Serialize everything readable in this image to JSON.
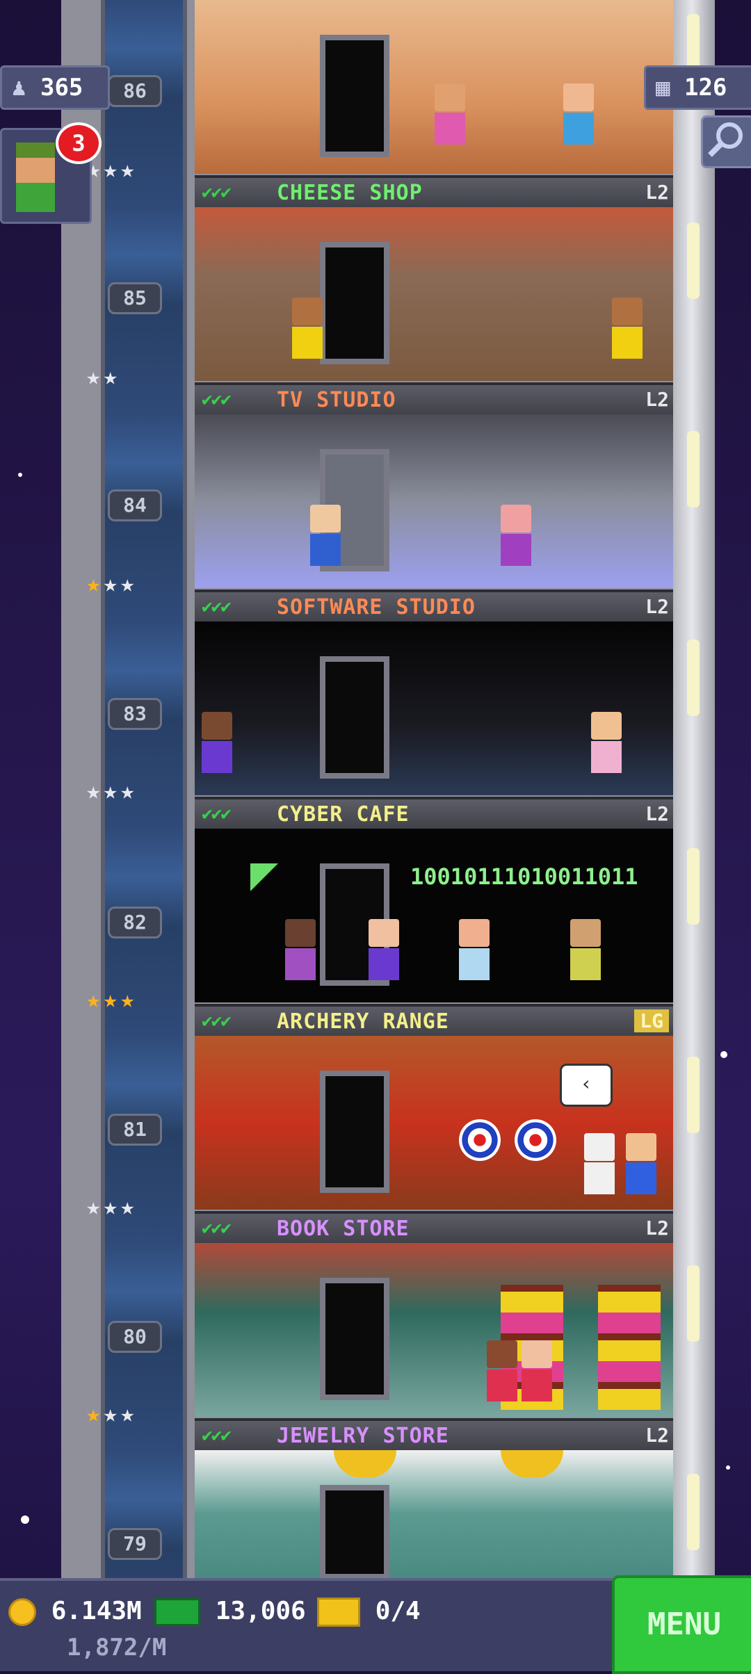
{
  "hud": {
    "population": "365",
    "floors": "126",
    "notifications": "3"
  },
  "floors": [
    {
      "number": "86",
      "name": "CHEESE SHOP",
      "name_color": "#6ef06e",
      "level": "L2",
      "checks": "✔✔✔",
      "stars": [
        "silver",
        "silver",
        "silver"
      ]
    },
    {
      "number": "85",
      "name": "TV STUDIO",
      "name_color": "#ff8a55",
      "level": "L2",
      "checks": "✔✔✔",
      "stars": [
        "silver",
        "silver"
      ]
    },
    {
      "number": "84",
      "name": "SOFTWARE STUDIO",
      "name_color": "#ff8a55",
      "level": "L2",
      "checks": "✔✔✔",
      "stars": [
        "gold",
        "silver",
        "silver"
      ]
    },
    {
      "number": "83",
      "name": "CYBER CAFE",
      "name_color": "#f3f08a",
      "level": "L2",
      "checks": "✔✔✔",
      "stars": [
        "silver",
        "silver",
        "silver"
      ]
    },
    {
      "number": "82",
      "name": "ARCHERY RANGE",
      "name_color": "#f3f08a",
      "level": "LG",
      "checks": "✔✔✔",
      "stars": [
        "gold",
        "gold",
        "gold"
      ],
      "code_text": "10010111010011011"
    },
    {
      "number": "81",
      "name": "BOOK STORE",
      "name_color": "#d890ff",
      "level": "L2",
      "checks": "✔✔✔",
      "stars": [
        "silver",
        "silver",
        "silver"
      ]
    },
    {
      "number": "80",
      "name": "JEWELRY STORE",
      "name_color": "#d890ff",
      "level": "L2",
      "checks": "✔✔✔",
      "stars": [
        "gold",
        "silver",
        "silver"
      ]
    },
    {
      "number": "79"
    }
  ],
  "bottom_bar": {
    "coins": "6.143M",
    "bux": "13,006",
    "tickets": "0/4",
    "income": "1,872/M",
    "menu_label": "MENU"
  },
  "icons": {
    "population": "person-icon",
    "floors": "building-icon",
    "search": "magnifier-icon",
    "coin": "coin-icon",
    "bux": "bux-icon",
    "ticket": "ticket-icon"
  }
}
